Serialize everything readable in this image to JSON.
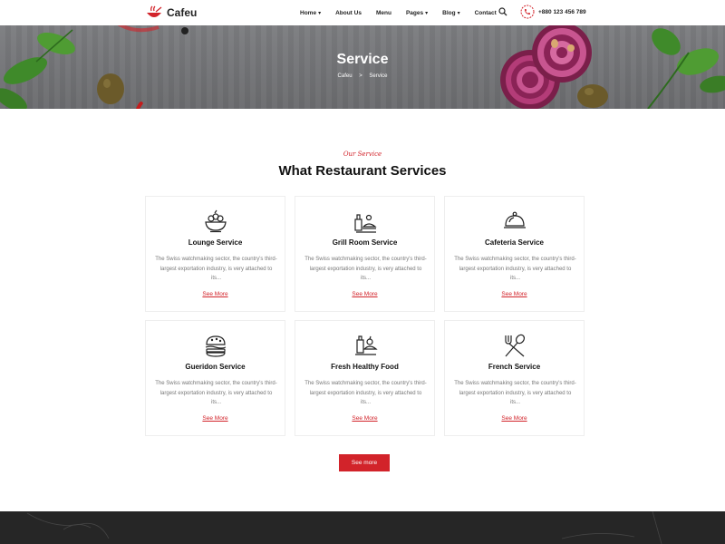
{
  "brand": {
    "name": "Cafeu",
    "accent": "#d2232a"
  },
  "nav": {
    "items": [
      {
        "label": "Home",
        "dropdown": true
      },
      {
        "label": "About Us",
        "dropdown": false
      },
      {
        "label": "Menu",
        "dropdown": false
      },
      {
        "label": "Pages",
        "dropdown": true
      },
      {
        "label": "Blog",
        "dropdown": true
      },
      {
        "label": "Contact",
        "dropdown": false
      }
    ],
    "phone": "+880 123 456 789"
  },
  "hero": {
    "title": "Service",
    "breadcrumb": {
      "home": "Cafeu",
      "sep": ">",
      "current": "Service"
    }
  },
  "section": {
    "subtitle": "Our Service",
    "title": "What Restaurant Services"
  },
  "services": [
    {
      "icon": "salad-bowl-icon",
      "title": "Lounge Service",
      "desc": "The Swiss watchmaking sector, the country's third-largest exportation industry, is very attached to its...",
      "link": "See More"
    },
    {
      "icon": "grill-room-icon",
      "title": "Grill Room Service",
      "desc": "The Swiss watchmaking sector, the country's third-largest exportation industry, is very attached to its...",
      "link": "See More"
    },
    {
      "icon": "cloche-icon",
      "title": "Cafeteria Service",
      "desc": "The Swiss watchmaking sector, the country's third-largest exportation industry, is very attached to its...",
      "link": "See More"
    },
    {
      "icon": "burger-icon",
      "title": "Gueridon Service",
      "desc": "The Swiss watchmaking sector, the country's third-largest exportation industry, is very attached to its...",
      "link": "See More"
    },
    {
      "icon": "healthy-food-icon",
      "title": "Fresh Healthy Food",
      "desc": "The Swiss watchmaking sector, the country's third-largest exportation industry, is very attached to its...",
      "link": "See More"
    },
    {
      "icon": "fork-spoon-icon",
      "title": "French Service",
      "desc": "The Swiss watchmaking sector, the country's third-largest exportation industry, is very attached to its...",
      "link": "See More"
    }
  ],
  "see_more_button": "See more"
}
